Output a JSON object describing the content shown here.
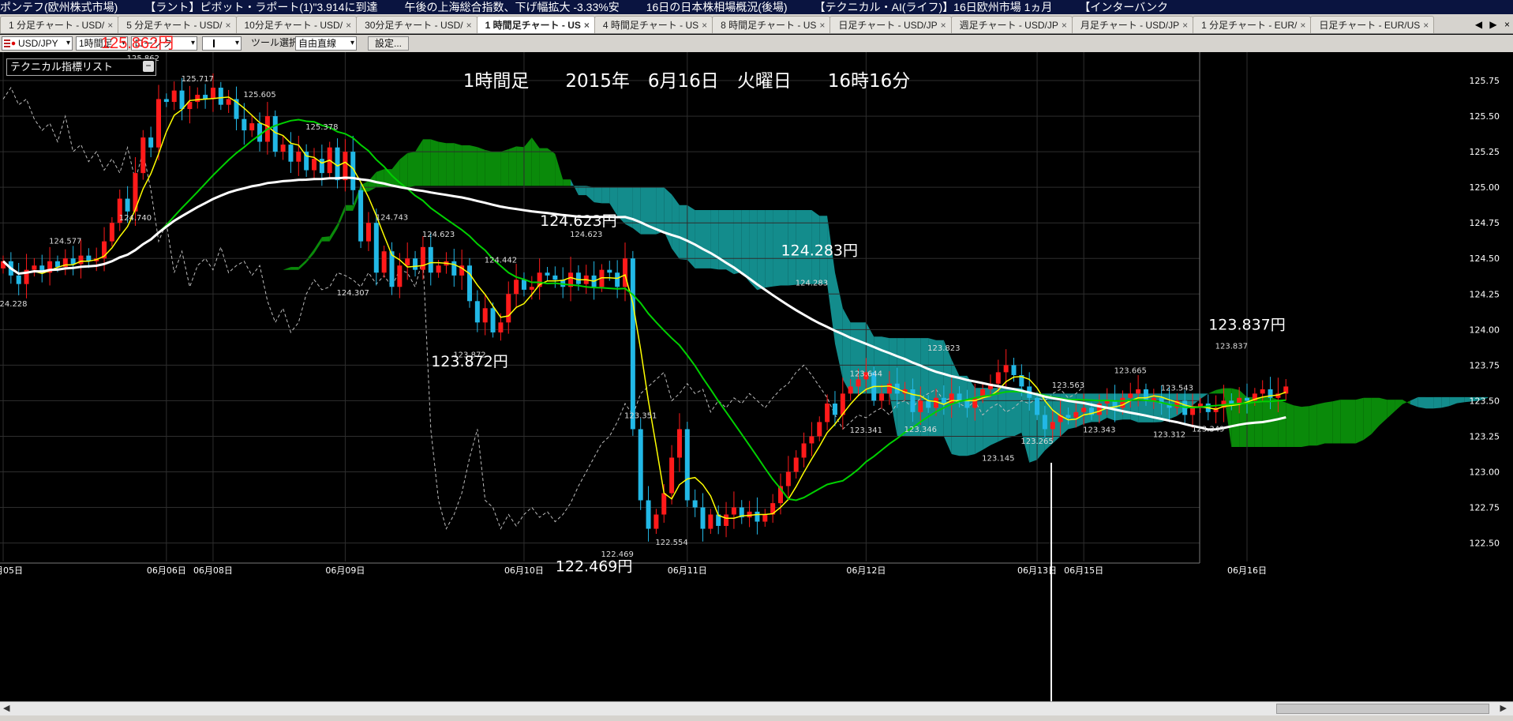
{
  "ticker": [
    "ポンテフ(欧州株式市場)",
    "【ラント】ピボット・ラポート(1)\"3.914に到達",
    "午後の上海総合指数、下げ幅拡大 -3.33%安",
    "16日の日本株相場概況(後場)",
    "【テクニカル・AI(ライフ)】16日欧州市場 1ヵ月",
    "【インターバンク"
  ],
  "tabs": [
    {
      "label": "1 分足チャート - USD/",
      "active": false
    },
    {
      "label": "5 分足チャート - USD/",
      "active": false
    },
    {
      "label": "10分足チャート - USD/",
      "active": false
    },
    {
      "label": "30分足チャート - USD/",
      "active": false
    },
    {
      "label": "1 時間足チャート - US",
      "active": true
    },
    {
      "label": "4 時間足チャート - US",
      "active": false
    },
    {
      "label": "8 時間足チャート - US",
      "active": false
    },
    {
      "label": "日足チャート - USD/JP",
      "active": false
    },
    {
      "label": "週足チャート - USD/JP",
      "active": false
    },
    {
      "label": "月足チャート - USD/JP",
      "active": false
    },
    {
      "label": "1 分足チャート - EUR/",
      "active": false
    },
    {
      "label": "日足チャート - EUR/US",
      "active": false
    }
  ],
  "tab_close": "×",
  "tab_nav": [
    "◀",
    "▶",
    "×"
  ],
  "toolbar": {
    "pair": "USD/JPY",
    "timeframe": "1時間足",
    "chart_type": "ローソク",
    "tool_label": "ツール選択",
    "tool_value": "自由直線",
    "settings": "設定..."
  },
  "price_label": "125.862円",
  "indicator_list": {
    "label": "テクニカル指標リスト",
    "toggle": "−"
  },
  "colors": {
    "background": "#000000",
    "bull": "#ff1a1a",
    "bear": "#22b8e6",
    "cloud_up": "#0a8a0a",
    "cloud_down": "#138c8c",
    "sma_fast": "#ffff00",
    "sma_mid": "#00d000",
    "sma_slow": "#ffffff",
    "lagging": "#bcbcbc",
    "grid": "#2e2e2e"
  },
  "chart_data": {
    "type": "candlestick",
    "title": "1時間足　　2015年　6月16日　火曜日　　16時16分",
    "ylim": [
      122.37,
      125.95
    ],
    "y_ticks": [
      "125.75",
      "125.50",
      "125.25",
      "125.00",
      "124.75",
      "124.50",
      "124.25",
      "124.00",
      "123.75",
      "123.50",
      "123.25",
      "123.00",
      "122.75",
      "122.50"
    ],
    "x_ticks": [
      "06月05日",
      "06月06日",
      "06月08日",
      "06月09日",
      "06月10日",
      "06月11日",
      "06月12日",
      "06月13日",
      "06月15日",
      "06月16日"
    ],
    "x_tick_bars": [
      0,
      21,
      27,
      44,
      67,
      88,
      111,
      133,
      139,
      160
    ],
    "candle_count": 170,
    "closes": [
      124.48,
      124.38,
      124.32,
      124.42,
      124.45,
      124.4,
      124.48,
      124.44,
      124.5,
      124.46,
      124.52,
      124.48,
      124.5,
      124.62,
      124.75,
      124.92,
      124.83,
      125.1,
      125.35,
      125.28,
      125.62,
      125.6,
      125.68,
      125.55,
      125.6,
      125.65,
      125.62,
      125.7,
      125.58,
      125.62,
      125.48,
      125.4,
      125.45,
      125.32,
      125.5,
      125.25,
      125.3,
      125.18,
      125.25,
      125.12,
      125.2,
      125.1,
      125.28,
      125.05,
      125.25,
      124.98,
      124.62,
      124.75,
      124.4,
      124.55,
      124.3,
      124.45,
      124.5,
      124.42,
      124.58,
      124.4,
      124.45,
      124.48,
      124.38,
      124.45,
      124.2,
      124.05,
      124.15,
      123.98,
      124.05,
      124.25,
      124.35,
      124.28,
      124.3,
      124.4,
      124.38,
      124.35,
      124.3,
      124.4,
      124.32,
      124.38,
      124.3,
      124.42,
      124.4,
      124.3,
      124.5,
      123.3,
      122.8,
      122.6,
      122.7,
      122.85,
      123.1,
      123.3,
      122.8,
      122.75,
      122.6,
      122.7,
      122.62,
      122.7,
      122.75,
      122.68,
      122.72,
      122.65,
      122.7,
      122.78,
      122.9,
      123.0,
      123.1,
      123.2,
      123.25,
      123.35,
      123.48,
      123.4,
      123.55,
      123.6,
      123.65,
      123.7,
      123.5,
      123.55,
      123.62,
      123.55,
      123.58,
      123.42,
      123.5,
      123.45,
      123.52,
      123.48,
      123.55,
      123.5,
      123.45,
      123.52,
      123.58,
      123.62,
      123.7,
      123.75,
      123.68,
      123.6,
      123.52,
      123.4,
      123.3,
      123.35,
      123.4,
      123.38,
      123.42,
      123.45,
      123.4,
      123.48,
      123.5,
      123.45,
      123.52,
      123.55,
      123.58,
      123.5,
      123.52,
      123.48,
      123.45,
      123.5,
      123.4,
      123.45,
      123.48,
      123.42,
      123.45,
      123.5,
      123.48,
      123.52,
      123.5,
      123.55,
      123.58,
      123.52,
      123.55,
      123.6
    ],
    "price_tags": [
      {
        "bar": 1,
        "price": 124.228,
        "label": "124.228",
        "pos": "below"
      },
      {
        "bar": 8,
        "price": 124.577,
        "label": "124.577",
        "pos": "above"
      },
      {
        "bar": 17,
        "price": 124.74,
        "label": "124.740",
        "pos": "above"
      },
      {
        "bar": 18,
        "price": 125.862,
        "label": "125.862",
        "pos": "above"
      },
      {
        "bar": 25,
        "price": 125.717,
        "label": "125.717",
        "pos": "above"
      },
      {
        "bar": 33,
        "price": 125.605,
        "label": "125.605",
        "pos": "above"
      },
      {
        "bar": 41,
        "price": 125.378,
        "label": "125.378",
        "pos": "above"
      },
      {
        "bar": 45,
        "price": 124.307,
        "label": "124.307",
        "pos": "below"
      },
      {
        "bar": 50,
        "price": 124.743,
        "label": "124.743",
        "pos": "above"
      },
      {
        "bar": 56,
        "price": 124.623,
        "label": "124.623",
        "pos": "above"
      },
      {
        "bar": 60,
        "price": 123.872,
        "label": "123.872",
        "pos": "below"
      },
      {
        "bar": 64,
        "price": 124.442,
        "label": "124.442",
        "pos": "above"
      },
      {
        "bar": 75,
        "price": 124.623,
        "label": "124.623",
        "pos": "above"
      },
      {
        "bar": 79,
        "price": 122.469,
        "label": "122.469",
        "pos": "below"
      },
      {
        "bar": 82,
        "price": 123.351,
        "label": "123.351",
        "pos": "above"
      },
      {
        "bar": 86,
        "price": 122.554,
        "label": "122.554",
        "pos": "below"
      },
      {
        "bar": 104,
        "price": 124.283,
        "label": "124.283",
        "pos": "above"
      },
      {
        "bar": 111,
        "price": 123.644,
        "label": "123.644",
        "pos": "above"
      },
      {
        "bar": 111,
        "price": 123.341,
        "label": "123.341",
        "pos": "below"
      },
      {
        "bar": 118,
        "price": 123.346,
        "label": "123.346",
        "pos": "below"
      },
      {
        "bar": 121,
        "price": 123.823,
        "label": "123.823",
        "pos": "above"
      },
      {
        "bar": 128,
        "price": 123.145,
        "label": "123.145",
        "pos": "below"
      },
      {
        "bar": 133,
        "price": 123.265,
        "label": "123.265",
        "pos": "below"
      },
      {
        "bar": 137,
        "price": 123.563,
        "label": "123.563",
        "pos": "above"
      },
      {
        "bar": 141,
        "price": 123.343,
        "label": "123.343",
        "pos": "below"
      },
      {
        "bar": 145,
        "price": 123.665,
        "label": "123.665",
        "pos": "above"
      },
      {
        "bar": 150,
        "price": 123.312,
        "label": "123.312",
        "pos": "below"
      },
      {
        "bar": 151,
        "price": 123.543,
        "label": "123.543",
        "pos": "above"
      },
      {
        "bar": 155,
        "price": 123.349,
        "label": "123.349",
        "pos": "below"
      },
      {
        "bar": 158,
        "price": 123.837,
        "label": "123.837",
        "pos": "above"
      }
    ],
    "annotations": [
      {
        "text": "124.623円",
        "bar": 74,
        "price": 124.73
      },
      {
        "text": "124.283円",
        "bar": 105,
        "price": 124.52
      },
      {
        "text": "123.872円",
        "bar": 60,
        "price": 123.74
      },
      {
        "text": "122.469円",
        "bar": 76,
        "price": 122.3
      },
      {
        "text": "123.837円",
        "bar": 160,
        "price": 124.0
      }
    ]
  }
}
